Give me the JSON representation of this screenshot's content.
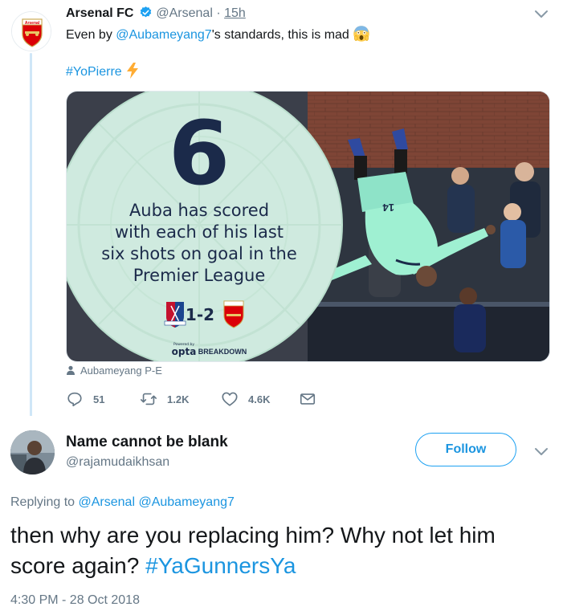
{
  "parent_tweet": {
    "name": "Arsenal FC",
    "handle": "@Arsenal",
    "separator": "·",
    "time": "15h",
    "text_prefix": "Even by ",
    "mention": "@Aubameyang7",
    "text_suffix": "'s standards, this is mad",
    "hashtag": "#YoPierre",
    "avatar_logo_text": "Arsenal",
    "media": {
      "big_number": "6",
      "stat_line_1": "Auba has scored",
      "stat_line_2": "with each of his last",
      "stat_line_3": "six shots on goal in the",
      "stat_line_4": "Premier League",
      "score": "1-2",
      "powered_by": "Powered by",
      "brand_opta": "opta",
      "brand_breakdown": "BREAKDOWN",
      "shirt_number": "14",
      "home_crest_logo_text": "CPFC",
      "away_crest_logo_text": "Arsenal"
    },
    "tagged_user": "Aubameyang P-E",
    "replies": "51",
    "retweets": "1.2K",
    "likes": "4.6K"
  },
  "reply_tweet": {
    "name": "Name cannot be blank",
    "handle": "@rajamudaikhsan",
    "follow_label": "Follow",
    "replying_prefix": "Replying to ",
    "replying_to_1": "@Arsenal",
    "replying_to_2": "@Aubameyang7",
    "text": "then why are you replacing him? Why not let him score again? ",
    "hashtag": "#YaGunnersYa",
    "timestamp": "4:30 PM - 28 Oct 2018"
  },
  "colors": {
    "link": "#1b95e0",
    "muted": "#657786",
    "text": "#14171a",
    "arsenal_red": "#db0007",
    "graphic_green": "#cfeadf",
    "graphic_navy": "#1b2a4a",
    "thread_line": "#cfe6f7"
  },
  "icons": [
    "verified-badge-icon",
    "chevron-down-icon",
    "scream-emoji-icon",
    "lightning-bolt-icon",
    "person-icon",
    "reply-icon",
    "retweet-icon",
    "like-icon",
    "direct-message-icon"
  ]
}
